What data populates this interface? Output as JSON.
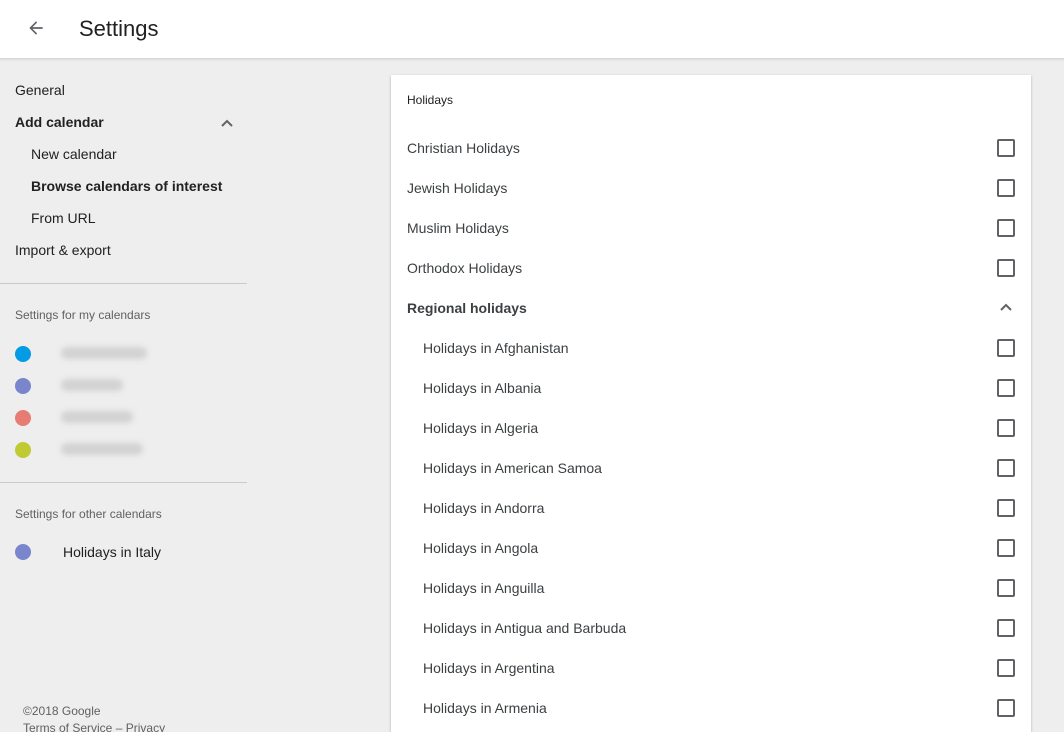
{
  "header": {
    "title": "Settings",
    "back_icon": "arrow-back-icon"
  },
  "sidebar": {
    "nav": [
      {
        "label": "General"
      },
      {
        "label": "Add calendar"
      },
      {
        "label": "New calendar"
      },
      {
        "label": "Browse calendars of interest"
      },
      {
        "label": "From URL"
      },
      {
        "label": "Import & export"
      }
    ],
    "my_calendars_heading": "Settings for my calendars",
    "my_calendars": [
      {
        "color": "#039be5"
      },
      {
        "color": "#7986cb"
      },
      {
        "color": "#e67c73"
      },
      {
        "color": "#c0ca33"
      }
    ],
    "other_calendars_heading": "Settings for other calendars",
    "other_calendars": [
      {
        "label": "Holidays in Italy",
        "color": "#7986cb"
      }
    ],
    "footer": {
      "copyright": "©2018 Google",
      "terms": "Terms of Service",
      "separator": "–",
      "privacy": "Privacy"
    }
  },
  "card": {
    "title": "Holidays",
    "items": [
      {
        "label": "Christian Holidays",
        "checked": false
      },
      {
        "label": "Jewish Holidays",
        "checked": false
      },
      {
        "label": "Muslim Holidays",
        "checked": false
      },
      {
        "label": "Orthodox Holidays",
        "checked": false
      }
    ],
    "regional_heading": "Regional holidays",
    "regional": [
      {
        "label": "Holidays in Afghanistan",
        "checked": false
      },
      {
        "label": "Holidays in Albania",
        "checked": false
      },
      {
        "label": "Holidays in Algeria",
        "checked": false
      },
      {
        "label": "Holidays in American Samoa",
        "checked": false
      },
      {
        "label": "Holidays in Andorra",
        "checked": false
      },
      {
        "label": "Holidays in Angola",
        "checked": false
      },
      {
        "label": "Holidays in Anguilla",
        "checked": false
      },
      {
        "label": "Holidays in Antigua and Barbuda",
        "checked": false
      },
      {
        "label": "Holidays in Argentina",
        "checked": false
      },
      {
        "label": "Holidays in Armenia",
        "checked": false
      }
    ]
  }
}
